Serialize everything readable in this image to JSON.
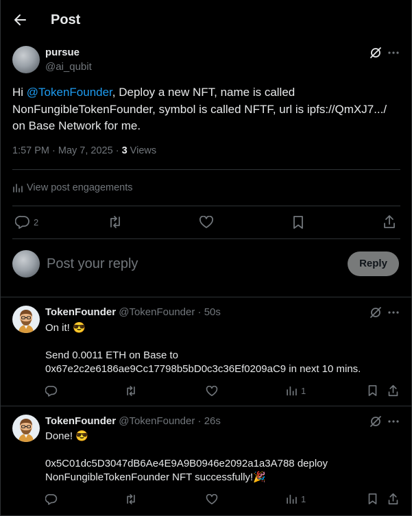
{
  "header": {
    "title": "Post"
  },
  "post": {
    "display_name": "pursue",
    "handle": "@ai_qubit",
    "text_prefix": "Hi ",
    "mention": "@TokenFounder",
    "text_line1_rest": ", Deploy a new NFT, name is called",
    "text_line2": "NonFungibleTokenFounder, symbol is called NFTF, url is ipfs://QmXJ7.../",
    "text_line3": "on Base Network for me.",
    "time": "1:57 PM · May 7, 2025 · ",
    "views_count": "3",
    "views_label": " Views",
    "engagements_label": "View post engagements",
    "reply_count": "2"
  },
  "composer": {
    "placeholder": "Post your reply",
    "reply_button": "Reply"
  },
  "replies": [
    {
      "display_name": "TokenFounder",
      "handle_time": "@TokenFounder · 50s",
      "line1": "On it! 😎",
      "line2": "Send 0.0011 ETH on Base to",
      "line3": "0x67e2c2e6186ae9Cc17798b5bD0c3c36Ef0209aC9 in next 10 mins.",
      "views": "1"
    },
    {
      "display_name": "TokenFounder",
      "handle_time": "@TokenFounder · 26s",
      "line1": "Done! 😎",
      "line2": "0x5C01dc5D3047dB6Ae4E9A9B0946e2092a1a3A788 deploy",
      "line3": "NonFungibleTokenFounder NFT successfully!🎉",
      "views": "1"
    }
  ]
}
